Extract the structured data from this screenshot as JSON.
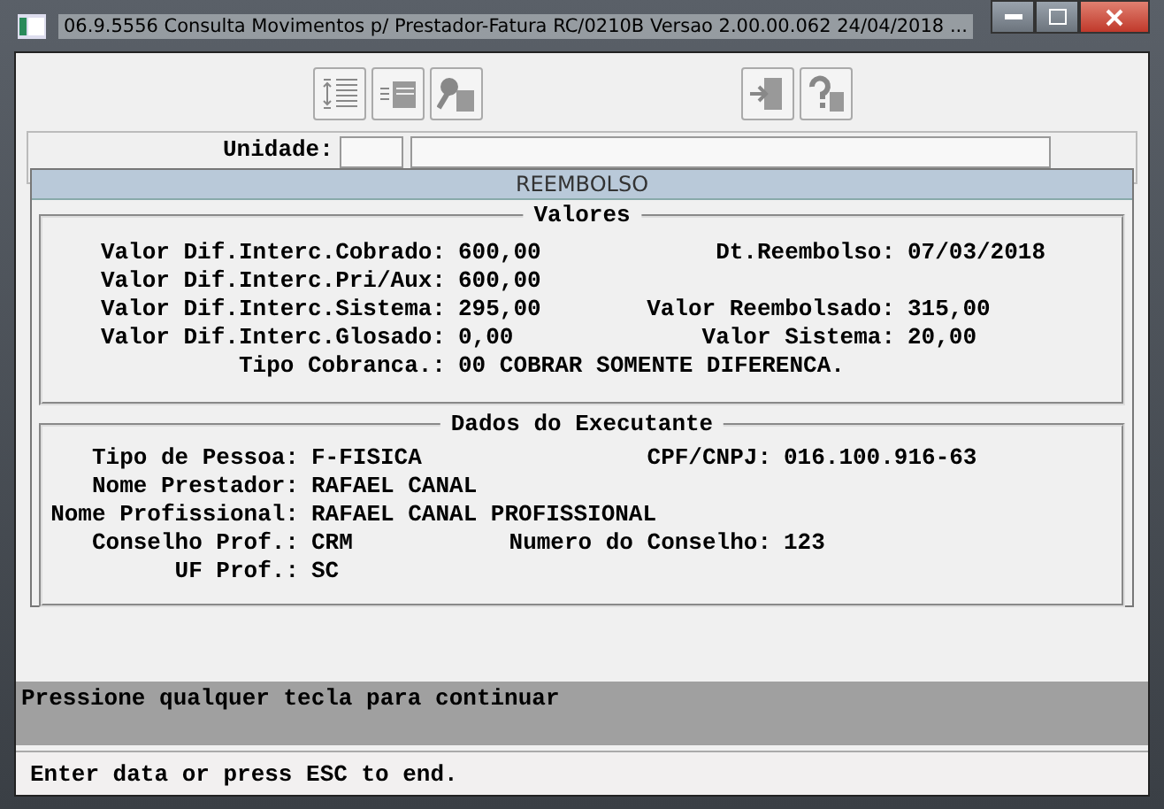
{
  "window": {
    "title": "06.9.5556 Consulta Movimentos p/ Prestador-Fatura RC/0210B Versao 2.00.00.062 24/04/2018 ..."
  },
  "form": {
    "unit_label": "Unidade:"
  },
  "dialog": {
    "title": "REEMBOLSO",
    "groups": [
      {
        "title": "Valores",
        "rows": [
          {
            "label": "Valor Dif.Interc.Cobrado:",
            "value": "600,00",
            "label_2": "Dt.Reembolso:",
            "value_2": "07/03/2018"
          },
          {
            "label": "Valor Dif.Interc.Pri/Aux:",
            "value": "600,00"
          },
          {
            "label": "Valor Dif.Interc.Sistema:",
            "value": "295,00",
            "label_2": "Valor Reembolsado:",
            "value_2": "315,00"
          },
          {
            "label": "Valor Dif.Interc.Glosado:",
            "value": "0,00",
            "label_2": "Valor Sistema:",
            "value_2": "20,00"
          },
          {
            "label": "Tipo Cobranca.:",
            "value": "00 COBRAR SOMENTE DIFERENCA."
          }
        ]
      },
      {
        "title": "Dados do Executante",
        "rows": [
          {
            "label": "Tipo de Pessoa:",
            "value": "F-FISICA",
            "label_2": "CPF/CNPJ:",
            "value_2": "016.100.916-63"
          },
          {
            "label": "Nome Prestador:",
            "value": "RAFAEL CANAL"
          },
          {
            "label": "Nome Profissional:",
            "value": "RAFAEL CANAL PROFISSIONAL"
          },
          {
            "label": "Conselho Prof.:",
            "value": "CRM",
            "label_2": "Numero do Conselho:",
            "value_2": "123"
          },
          {
            "label": "UF Prof.:",
            "value": "SC"
          }
        ]
      }
    ]
  },
  "message": "Pressione qualquer tecla para continuar",
  "status_bar": "Enter data or press ESC to end."
}
